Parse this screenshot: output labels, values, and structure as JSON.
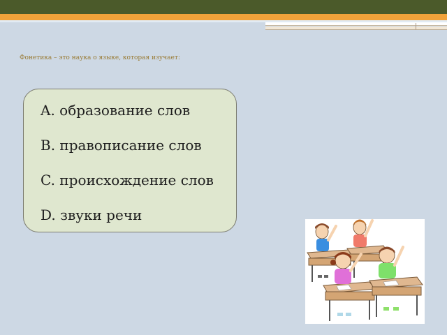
{
  "slide": {
    "question": "Фонетика – это наука о языке, которая изучает:",
    "answers": [
      "A.  образование слов",
      "B. правописание слов",
      "C. происхождение слов",
      "D. звуки речи"
    ],
    "illustration_icon": "classroom-children-raising-hands"
  },
  "colors": {
    "top_bar": "#4b5a2a",
    "orange_stripe": "#f0a23a",
    "background": "#cdd8e4",
    "answer_box": "#dfe7cf",
    "question_text": "#9a7c37"
  }
}
